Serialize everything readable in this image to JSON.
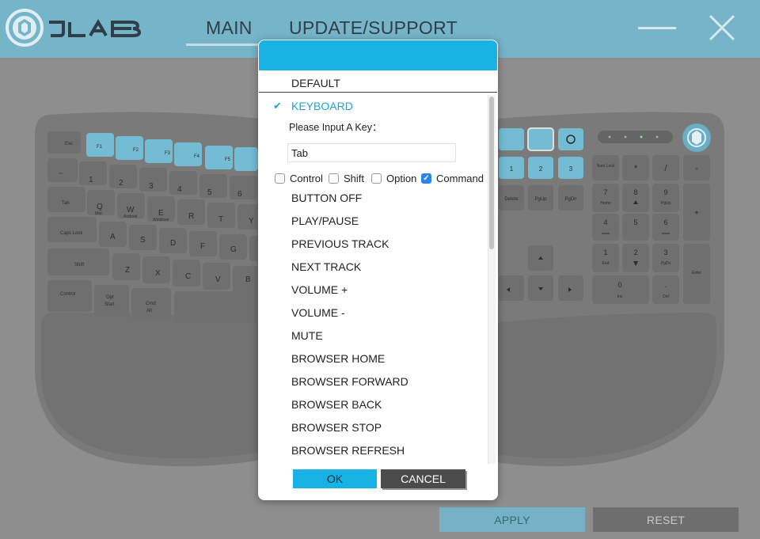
{
  "header": {
    "logo_text": "JLAB",
    "tabs": [
      {
        "label": "MAIN",
        "active": true
      },
      {
        "label": "UPDATE/SUPPORT",
        "active": false
      }
    ]
  },
  "keyboard_keys": {
    "esc": "Esc",
    "f1": "F1",
    "f2": "F2",
    "f3": "F3",
    "f4": "F4",
    "f5": "F5",
    "tilde": "~",
    "one": "1",
    "two": "2",
    "three": "3",
    "four": "4",
    "five": "5",
    "six": "6",
    "tab": "Tab",
    "q": "Q",
    "q_sub": "Mac",
    "w": "W",
    "w_sub": "Android",
    "e": "E",
    "e_sub": "Windows",
    "r": "R",
    "t": "T",
    "y": "Y",
    "caps": "Caps Lock",
    "a": "A",
    "s": "S",
    "d": "D",
    "f": "F",
    "g": "G",
    "shift": "Shift",
    "z": "Z",
    "x": "X",
    "c": "C",
    "v": "V",
    "b": "B",
    "control": "Control",
    "opt": "Opt",
    "opt_sub": "Start",
    "cmd": "Cmd",
    "cmd_sub": "Alt",
    "delete": "Delete",
    "pgup": "PgUp",
    "pgdn": "PgDn",
    "num_lock": "Num Lock",
    "star": "*",
    "slash": "/",
    "minus": "-",
    "plus": "+",
    "enter": "Enter",
    "n7": "7",
    "n7_sub": "Home",
    "n8": "8",
    "n9": "9",
    "n9_sub": "PgUp",
    "n4": "4",
    "n5": "5",
    "n6": "6",
    "n1": "1",
    "n1_sub": "End",
    "n2": "2",
    "n3": "3",
    "n3_sub": "PgDn",
    "n0": "0",
    "n0_sub": "Ins",
    "dot": ".",
    "dot_sub": "Del",
    "p1": "1",
    "p2": "2",
    "p3": "3"
  },
  "dialog": {
    "default_label": "DEFAULT",
    "keyboard_label": "KEYBOARD",
    "input_label": "Please Input A Key：",
    "key_value": "Tab",
    "modifiers": [
      {
        "label": "Control",
        "checked": false
      },
      {
        "label": "Shift",
        "checked": false
      },
      {
        "label": "Option",
        "checked": false
      },
      {
        "label": "Command",
        "checked": true
      }
    ],
    "options": [
      "BUTTON OFF",
      "PLAY/PAUSE",
      "PREVIOUS TRACK",
      "NEXT TRACK",
      "VOLUME +",
      "VOLUME -",
      "MUTE",
      "BROWSER HOME",
      "BROWSER FORWARD",
      "BROWSER BACK",
      "BROWSER STOP",
      "BROWSER REFRESH"
    ],
    "ok_label": "OK",
    "cancel_label": "CANCEL"
  },
  "footer": {
    "apply_label": "APPLY",
    "reset_label": "RESET"
  },
  "colors": {
    "header_bg": "#76b4c9",
    "accent": "#19b2e5",
    "highlight_key": "#73bcd3",
    "checkbox_on": "#2a84f0"
  }
}
